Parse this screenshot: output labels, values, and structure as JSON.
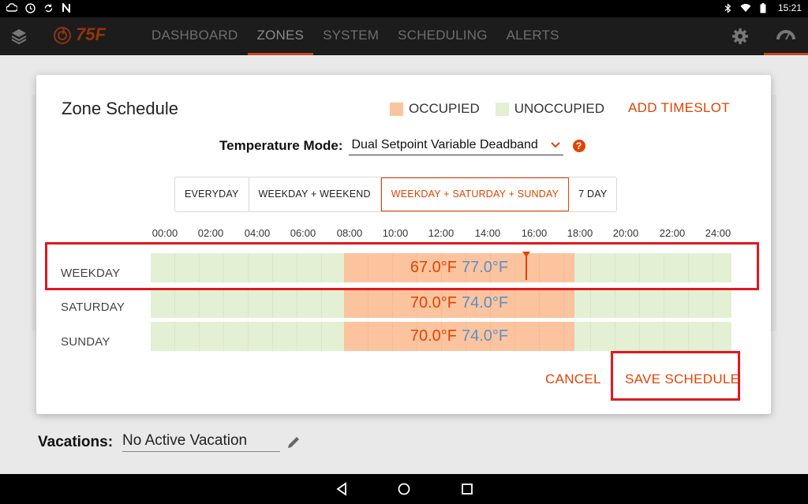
{
  "status_bar": {
    "time": "15:21"
  },
  "app_bar": {
    "logo_text": "75F",
    "nav": [
      "DASHBOARD",
      "ZONES",
      "SYSTEM",
      "SCHEDULING",
      "ALERTS"
    ],
    "active_nav": "ZONES"
  },
  "dialog": {
    "title": "Zone Schedule",
    "legend": {
      "occupied": {
        "label": "OCCUPIED",
        "color": "#fbc49e"
      },
      "unoccupied": {
        "label": "UNOCCUPIED",
        "color": "#e3f0d3"
      }
    },
    "add_timeslot": "ADD TIMESLOT",
    "temperature_mode": {
      "label": "Temperature Mode:",
      "value": "Dual Setpoint Variable Deadband"
    },
    "schedule_types": [
      "EVERYDAY",
      "WEEKDAY + WEEKEND",
      "WEEKDAY + SATURDAY + SUNDAY",
      "7 DAY"
    ],
    "selected_schedule_type": "WEEKDAY + SATURDAY + SUNDAY",
    "hours": [
      "00:00",
      "02:00",
      "04:00",
      "06:00",
      "08:00",
      "10:00",
      "12:00",
      "14:00",
      "16:00",
      "18:00",
      "20:00",
      "22:00",
      "24:00"
    ],
    "rows": [
      {
        "day": "WEEKDAY",
        "low": "67.0°F",
        "high": "77.0°F"
      },
      {
        "day": "SATURDAY",
        "low": "70.0°F",
        "high": "74.0°F"
      },
      {
        "day": "SUNDAY",
        "low": "70.0°F",
        "high": "74.0°F"
      }
    ],
    "cancel": "CANCEL",
    "save": "SAVE SCHEDULE"
  },
  "vacations": {
    "label": "Vacations:",
    "value": "No Active Vacation"
  },
  "colors": {
    "accent": "#e24301",
    "high_temp": "#5d8fc9",
    "highlight": "#e01820"
  }
}
